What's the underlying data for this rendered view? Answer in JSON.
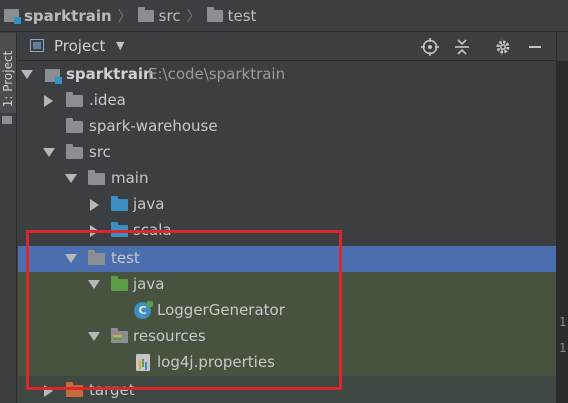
{
  "breadcrumb": [
    {
      "label": "sparktrain",
      "icon": "module-icon"
    },
    {
      "label": "src",
      "icon": "folder-icon"
    },
    {
      "label": "test",
      "icon": "folder-icon"
    }
  ],
  "side_tab": {
    "label": "1: Project"
  },
  "panel": {
    "title": "Project",
    "tools": [
      "locate-icon",
      "collapse-all-icon",
      "gear-icon",
      "hide-icon"
    ]
  },
  "tree": {
    "root": {
      "label": "sparktrain",
      "path": "E:\\code\\sparktrain"
    },
    "idea": {
      "label": ".idea"
    },
    "warehouse": {
      "label": "spark-warehouse"
    },
    "src": {
      "label": "src"
    },
    "main": {
      "label": "main"
    },
    "main_java": {
      "label": "java"
    },
    "scala": {
      "label": "scala"
    },
    "test": {
      "label": "test"
    },
    "test_java": {
      "label": "java"
    },
    "logger": {
      "label": "LoggerGenerator"
    },
    "resources": {
      "label": "resources"
    },
    "log4j": {
      "label": "log4j.properties"
    },
    "target": {
      "label": "target"
    }
  },
  "editor_gutter": [
    "1",
    "1"
  ],
  "colors": {
    "background": "#3c3f41",
    "selection": "#4b6eaf",
    "test_scope": "#48533f",
    "highlight_box": "#d9272e",
    "folder_blue": "#3d8fc1",
    "folder_green": "#5c9c44",
    "folder_orange": "#c66a3a"
  }
}
